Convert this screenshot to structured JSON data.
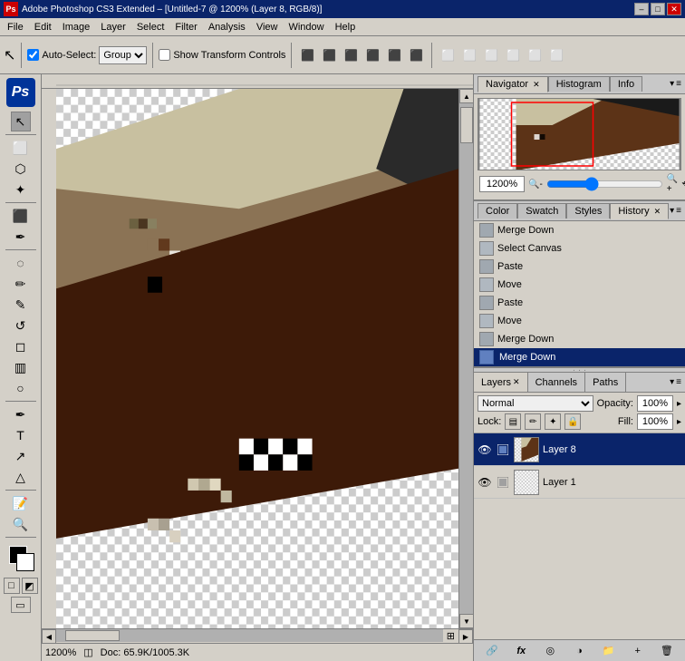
{
  "app": {
    "title": "Adobe Photoshop CS3 Extended - [Untitled-7 @ 1200% (Layer 8, RGB/8)]",
    "version": "CS3"
  },
  "titlebar": {
    "text": "Adobe Photoshop CS3 Extended – [Untitled-7 @ 1200% (Layer 8, RGB/8)]",
    "minimize": "–",
    "maximize": "□",
    "close": "✕"
  },
  "menubar": {
    "items": [
      "File",
      "Edit",
      "Image",
      "Layer",
      "Select",
      "Filter",
      "Analysis",
      "View",
      "Window",
      "Help"
    ]
  },
  "toolbar": {
    "auto_select_label": "Auto-Select:",
    "auto_select_value": "Group",
    "show_transform": "Show Transform Controls",
    "move_tool_symbol": "↖"
  },
  "left_tools": {
    "tools": [
      "↖",
      "✂",
      "⬡",
      "⬜",
      "✒",
      "✏",
      "✎",
      "⬛",
      "◻",
      "🪣",
      "✂",
      "⟲",
      "◯",
      "△",
      "T",
      "🔍",
      "✋",
      "🔲",
      "⬜",
      "⬛"
    ]
  },
  "navigator": {
    "tabs": [
      "Navigator",
      "Histogram",
      "Info"
    ],
    "zoom_value": "1200%",
    "active_tab": "Navigator"
  },
  "styles_panel": {
    "tabs": [
      "Color",
      "Swatch",
      "Styles",
      "History"
    ],
    "active_tab": "History",
    "history_items": [
      {
        "label": "Merge Down",
        "icon": "layer",
        "active": false
      },
      {
        "label": "Select Canvas",
        "icon": "select",
        "active": false
      },
      {
        "label": "Paste",
        "icon": "paste",
        "active": false
      },
      {
        "label": "Move",
        "icon": "move",
        "active": false
      },
      {
        "label": "Paste",
        "icon": "paste",
        "active": false
      },
      {
        "label": "Move",
        "icon": "move",
        "active": false
      },
      {
        "label": "Merge Down",
        "icon": "layer",
        "active": false
      },
      {
        "label": "Merge Down",
        "icon": "layer",
        "active": true
      }
    ]
  },
  "layers_panel": {
    "tabs": [
      "Layers",
      "Channels",
      "Paths"
    ],
    "active_tab": "Layers",
    "blend_mode": "Normal",
    "opacity": "100%",
    "fill": "100%",
    "lock_icons": [
      "🖊",
      "🔒",
      "🎨",
      "🔒"
    ],
    "layers": [
      {
        "name": "Layer 8",
        "visible": true,
        "active": true,
        "type": "normal"
      },
      {
        "name": "Layer 1",
        "visible": true,
        "active": false,
        "type": "normal"
      }
    ],
    "bottom_icons": [
      "🔗",
      "fx",
      "◎",
      "📋",
      "🗑"
    ]
  },
  "status_bar": {
    "zoom": "1200%",
    "doc_info": "Doc: 65.9K/1005.3K"
  },
  "canvas": {
    "background": "#808080"
  }
}
